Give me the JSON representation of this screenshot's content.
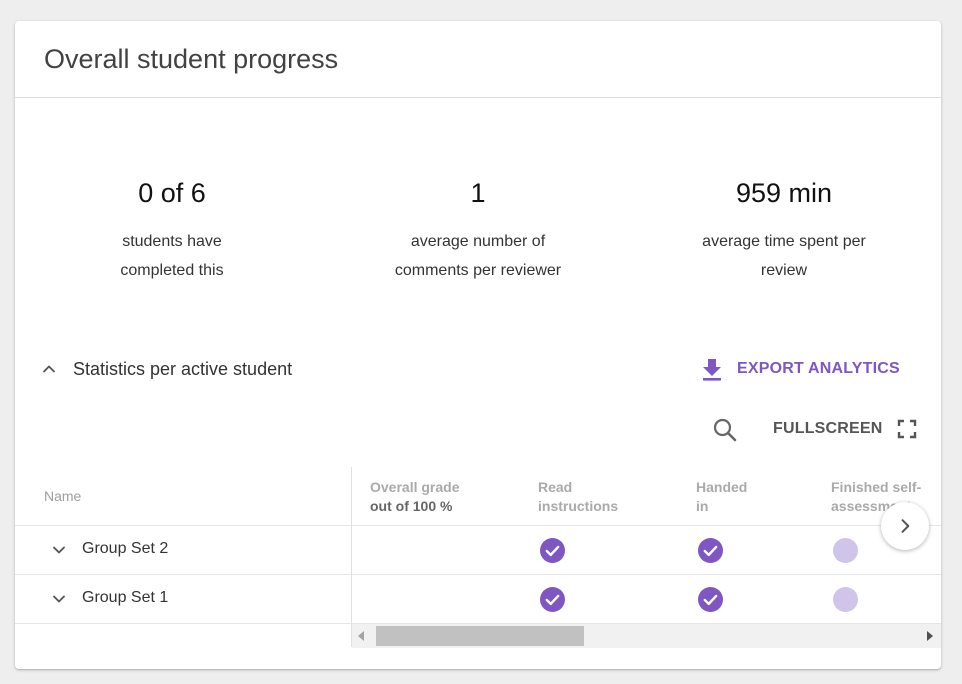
{
  "header": {
    "title": "Overall student progress"
  },
  "stats": [
    {
      "value": "0 of 6",
      "label_line1": "students have",
      "label_line2": "completed this"
    },
    {
      "value": "1",
      "label_line1": "average number of",
      "label_line2": "comments per reviewer"
    },
    {
      "value": "959 min",
      "label_line1": "average time spent per",
      "label_line2": "review"
    }
  ],
  "section": {
    "title": "Statistics per active student",
    "export_label": "EXPORT ANALYTICS",
    "fullscreen_label": "FULLSCREEN"
  },
  "table": {
    "columns": [
      {
        "line1": "Name",
        "line2": ""
      },
      {
        "line1": "Overall grade",
        "line2": "out of 100 %"
      },
      {
        "line1": "Read",
        "line2": "instructions"
      },
      {
        "line1": "Handed",
        "line2": "in"
      },
      {
        "line1": "Finished self-",
        "line2": "assessment"
      }
    ],
    "rows": [
      {
        "name": "Group Set 2",
        "overall_grade": "",
        "read_instructions": "done",
        "handed_in": "done",
        "self_assessment": "pending"
      },
      {
        "name": "Group Set 1",
        "overall_grade": "",
        "read_instructions": "done",
        "handed_in": "done",
        "self_assessment": "pending"
      }
    ]
  },
  "colors": {
    "accent": "#7e57c2",
    "done": "#7e57c2",
    "pending": "#d1c4e9"
  },
  "icons": {
    "collapse": "chevron-up-icon",
    "export": "download-icon",
    "search": "search-icon",
    "fullscreen": "fullscreen-icon",
    "row_expand": "chevron-down-icon",
    "next": "chevron-right-icon",
    "done": "check-circle-icon",
    "pending": "empty-circle-icon"
  }
}
